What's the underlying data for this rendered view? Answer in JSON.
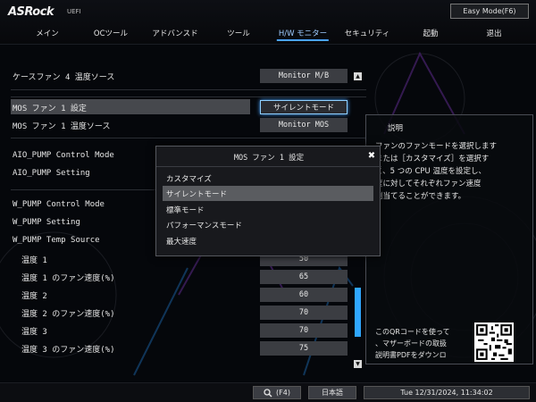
{
  "header": {
    "logo": "ASRock",
    "logo_sub": "UEFI",
    "easy_mode_label": "Easy Mode(F6)"
  },
  "tabs": [
    {
      "label": "メイン"
    },
    {
      "label": "OCツール"
    },
    {
      "label": "アドバンスド"
    },
    {
      "label": "ツール"
    },
    {
      "label": "H/W モニター"
    },
    {
      "label": "セキュリティ"
    },
    {
      "label": "起動"
    },
    {
      "label": "退出"
    }
  ],
  "active_tab": "H/W モニター",
  "settings": {
    "case_fan4_source": {
      "label": "ケースファン 4 温度ソース",
      "value": "Monitor M/B"
    },
    "mos_fan1_setting": {
      "label": "MOS ファン 1 設定",
      "value": "サイレントモード"
    },
    "mos_fan1_source": {
      "label": "MOS ファン 1 温度ソース",
      "value": "Monitor MOS"
    },
    "aio_pump_mode": {
      "label": "AIO_PUMP Control Mode"
    },
    "aio_pump_setting": {
      "label": "AIO_PUMP Setting"
    },
    "w_pump_mode": {
      "label": "W_PUMP Control Mode"
    },
    "w_pump_setting": {
      "label": "W_PUMP Setting"
    },
    "w_pump_source": {
      "label": "W_PUMP Temp Source"
    },
    "temp1": {
      "label": "温度 1",
      "value": "50"
    },
    "temp1_speed": {
      "label": "温度 1 のファン速度(%)",
      "value": "65"
    },
    "temp2": {
      "label": "温度 2",
      "value": "60"
    },
    "temp2_speed": {
      "label": "温度 2 のファン速度(%)",
      "value": "70"
    },
    "temp3": {
      "label": "温度 3",
      "value": "70"
    },
    "temp3_speed": {
      "label": "温度 3 のファン速度(%)",
      "value": "75"
    }
  },
  "description": {
    "title": "説明",
    "lines": [
      "ファンのファンモードを選択します",
      "または［カスタマイズ］を選択す",
      "と、5 つの CPU 温度を設定し、",
      "度に対してそれぞれファン速度",
      "割当てることができます。"
    ],
    "qr_lines": [
      "このQRコードを使って",
      "、マザーボードの取扱",
      "説明書PDFをダウンロ"
    ]
  },
  "popup": {
    "title": "MOS ファン 1 設定",
    "close_glyph": "✖",
    "options": [
      {
        "label": "カスタマイズ"
      },
      {
        "label": "サイレントモード"
      },
      {
        "label": "標準モード"
      },
      {
        "label": "パフォーマンスモード"
      },
      {
        "label": "最大速度"
      }
    ],
    "selected_index": 1
  },
  "footer": {
    "search_label": "(F4)",
    "language": "日本語",
    "datetime": "Tue 12/31/2024, 11:34:02"
  },
  "colors": {
    "accent": "#4aa3ff",
    "scrollbar": "#2fa6ff",
    "background": "#05070b"
  }
}
